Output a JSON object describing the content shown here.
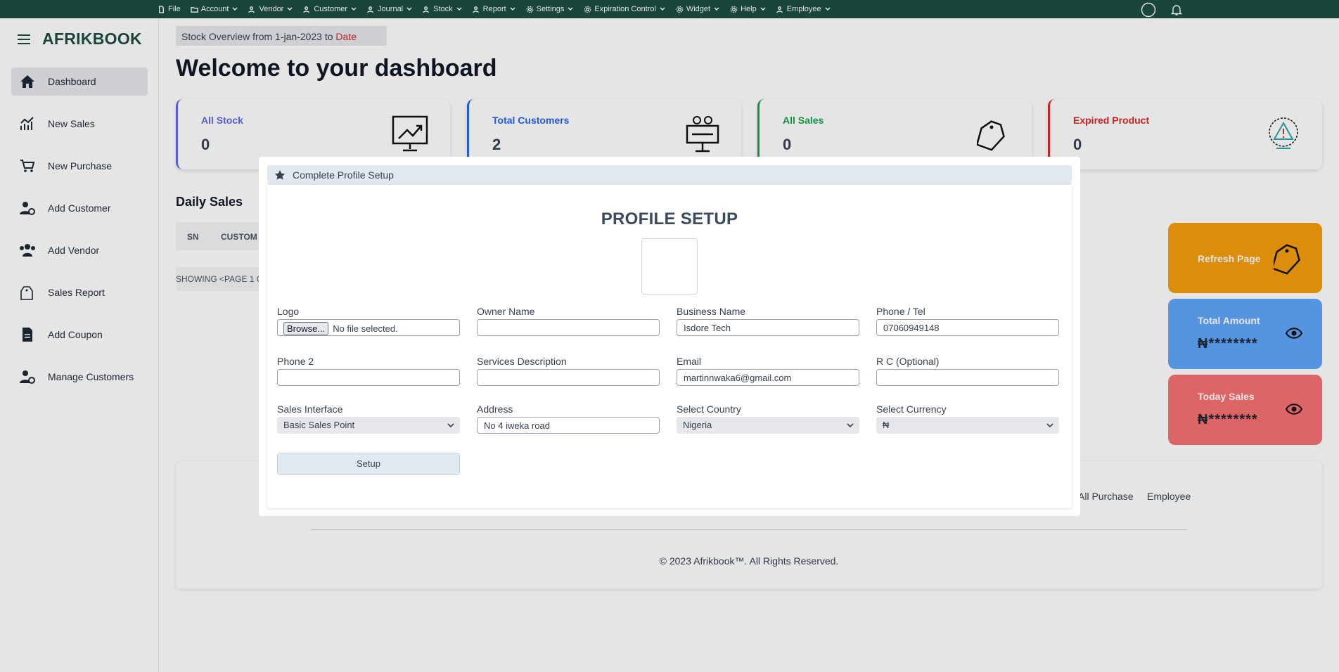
{
  "topbar": {
    "menus": [
      {
        "label": "File",
        "icon": "file-icon"
      },
      {
        "label": "Account",
        "icon": "folder-icon"
      },
      {
        "label": "Vendor",
        "icon": "users-icon"
      },
      {
        "label": "Customer",
        "icon": "users-icon"
      },
      {
        "label": "Journal",
        "icon": "users-icon"
      },
      {
        "label": "Stock",
        "icon": "users-icon"
      },
      {
        "label": "Report",
        "icon": "users-icon"
      },
      {
        "label": "Settings",
        "icon": "gear-icon"
      },
      {
        "label": "Expiration Control",
        "icon": "gear-icon"
      },
      {
        "label": "Widget",
        "icon": "gear-icon"
      },
      {
        "label": "Help",
        "icon": "gear-icon"
      },
      {
        "label": "Employee",
        "icon": "users-icon"
      }
    ]
  },
  "sidebar": {
    "brand": "AFRIKBOOK",
    "items": [
      {
        "label": "Dashboard",
        "icon": "home-icon"
      },
      {
        "label": "New Sales",
        "icon": "sales-chart-icon"
      },
      {
        "label": "New Purchase",
        "icon": "cart-icon"
      },
      {
        "label": "Add Customer",
        "icon": "user-gear-icon"
      },
      {
        "label": "Add Vendor",
        "icon": "users-icon"
      },
      {
        "label": "Sales Report",
        "icon": "sale-tag-icon"
      },
      {
        "label": "Add Coupon",
        "icon": "receipt-icon"
      },
      {
        "label": "Manage Customers",
        "icon": "user-gear-icon"
      }
    ]
  },
  "header": {
    "crumb_text": "Stock Overview from 1-jan-2023 to ",
    "crumb_date": "Date",
    "welcome": "Welcome to your dashboard"
  },
  "cards": [
    {
      "title": "All Stock",
      "value": "0",
      "color": "#6366f1"
    },
    {
      "title": "Total Customers",
      "value": "2",
      "color": "#2563eb"
    },
    {
      "title": "All Sales",
      "value": "0",
      "color": "#16a34a"
    },
    {
      "title": "Expired Product",
      "value": "0",
      "color": "#dc2626"
    }
  ],
  "daily": {
    "title": "Daily Sales",
    "col_sn": "SN",
    "col_customer": "CUSTOM",
    "showing": "SHOWING <PAGE 1 C"
  },
  "side_cards": {
    "refresh": "Refresh Page",
    "total_amount": "Total Amount",
    "total_amount_value": "₦********",
    "today_sales": "Today Sales",
    "today_sales_value": "₦********"
  },
  "footer": {
    "link_purchase": "All Purchase",
    "link_employee": "Employee",
    "copyright": "© 2023 Afrikbook™. All Rights Reserved."
  },
  "modal": {
    "header": "Complete Profile Setup",
    "title": "PROFILE SETUP",
    "fields": {
      "logo_label": "Logo",
      "logo_button": "Browse...",
      "logo_status": "No file selected.",
      "owner_label": "Owner Name",
      "owner_value": "",
      "business_label": "Business Name",
      "business_value": "Isdore Tech",
      "phone_label": "Phone / Tel",
      "phone_value": "07060949148",
      "phone2_label": "Phone 2",
      "phone2_value": "",
      "services_label": "Services Description",
      "services_value": "",
      "email_label": "Email",
      "email_value": "martinnwaka6@gmail.com",
      "rc_label": "R C (Optional)",
      "rc_value": "",
      "interface_label": "Sales Interface",
      "interface_value": "Basic Sales Point",
      "address_label": "Address",
      "address_value": "No 4 iweka road",
      "country_label": "Select Country",
      "country_value": "Nigeria",
      "currency_label": "Select Currency",
      "currency_value": "₦"
    },
    "setup_button": "Setup"
  }
}
